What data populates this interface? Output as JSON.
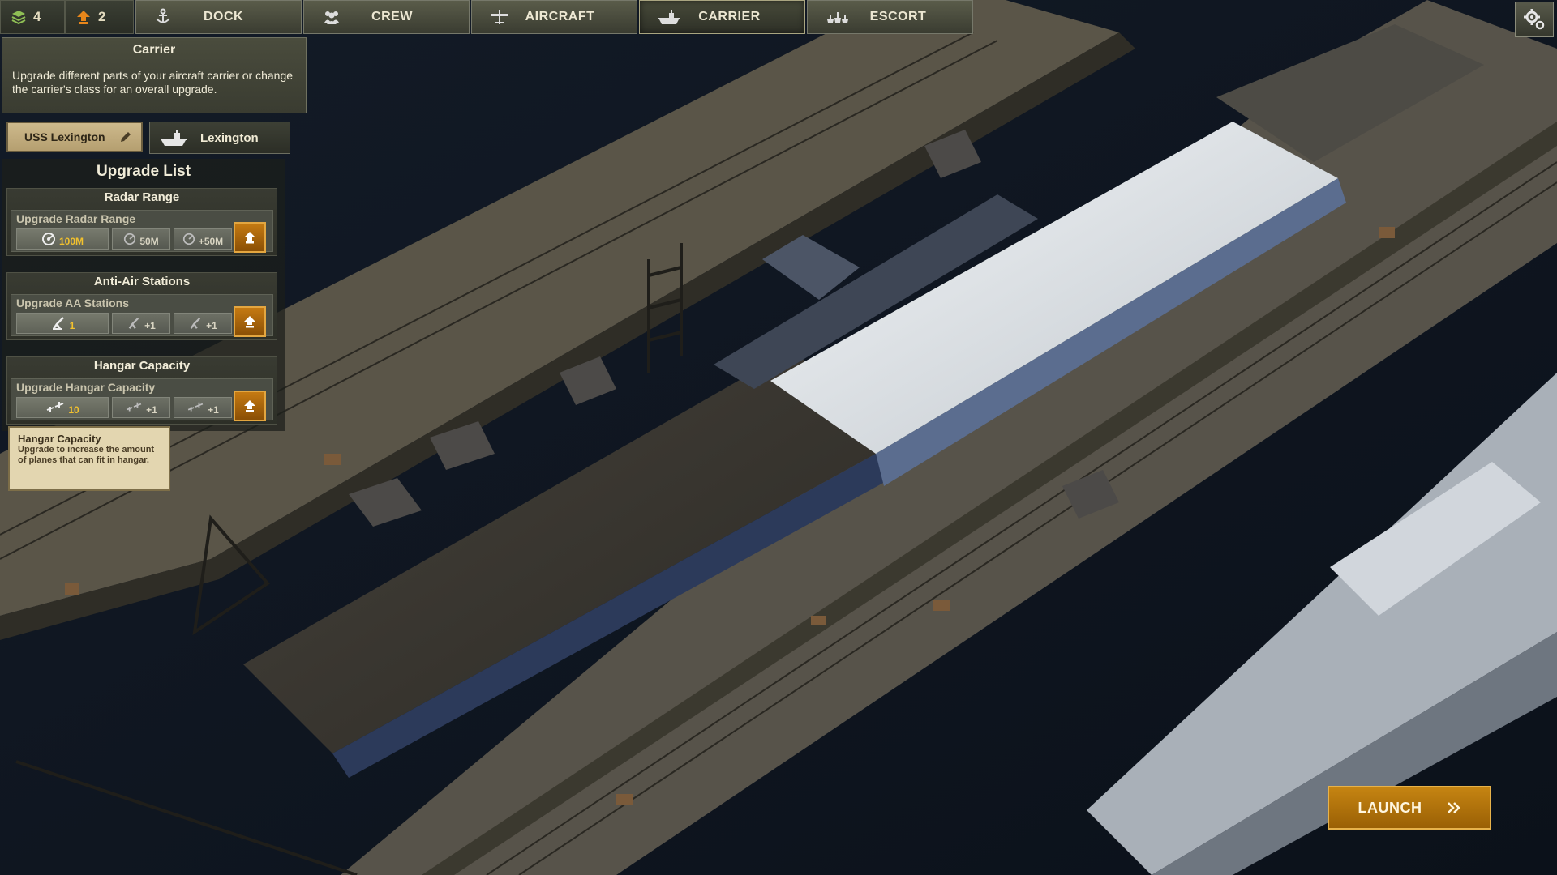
{
  "resources": {
    "parts_count": "4",
    "upgrade_points": "2"
  },
  "tabs": [
    {
      "label": "DOCK",
      "icon": "anchor-icon",
      "active": false
    },
    {
      "label": "CREW",
      "icon": "crew-icon",
      "active": false
    },
    {
      "label": "AIRCRAFT",
      "icon": "plane-icon",
      "active": false
    },
    {
      "label": "CARRIER",
      "icon": "carrier-icon",
      "active": true
    },
    {
      "label": "ESCORT",
      "icon": "escort-icon",
      "active": false
    }
  ],
  "panel": {
    "title": "Carrier",
    "description": "Upgrade different parts of your aircraft carrier or change the carrier's class for an overall upgrade.",
    "ship_name": "USS Lexington",
    "ship_class": "Lexington"
  },
  "upgrade_list": {
    "title": "Upgrade List",
    "sections": [
      {
        "name": "Radar Range",
        "subtitle": "Upgrade Radar Range",
        "current": "100M",
        "levels": [
          "50M",
          "+50M"
        ],
        "icon": "radar-icon"
      },
      {
        "name": "Anti-Air Stations",
        "subtitle": "Upgrade AA Stations",
        "current": "1",
        "levels": [
          "+1",
          "+1"
        ],
        "icon": "aa-gun-icon"
      },
      {
        "name": "Hangar Capacity",
        "subtitle": "Upgrade Hangar Capacity",
        "current": "10",
        "levels": [
          "+1",
          "+1"
        ],
        "icon": "planes-icon"
      }
    ]
  },
  "tooltip": {
    "title": "Hangar Capacity",
    "body": "Upgrade to increase the amount of planes that can fit in hangar."
  },
  "launch_label": "LAUNCH",
  "colors": {
    "accent_orange": "#c57a12",
    "panel_olive": "#4a4c3d",
    "current_level_yellow": "#f2c12e",
    "tooltip_bg": "#e3d6b0"
  }
}
